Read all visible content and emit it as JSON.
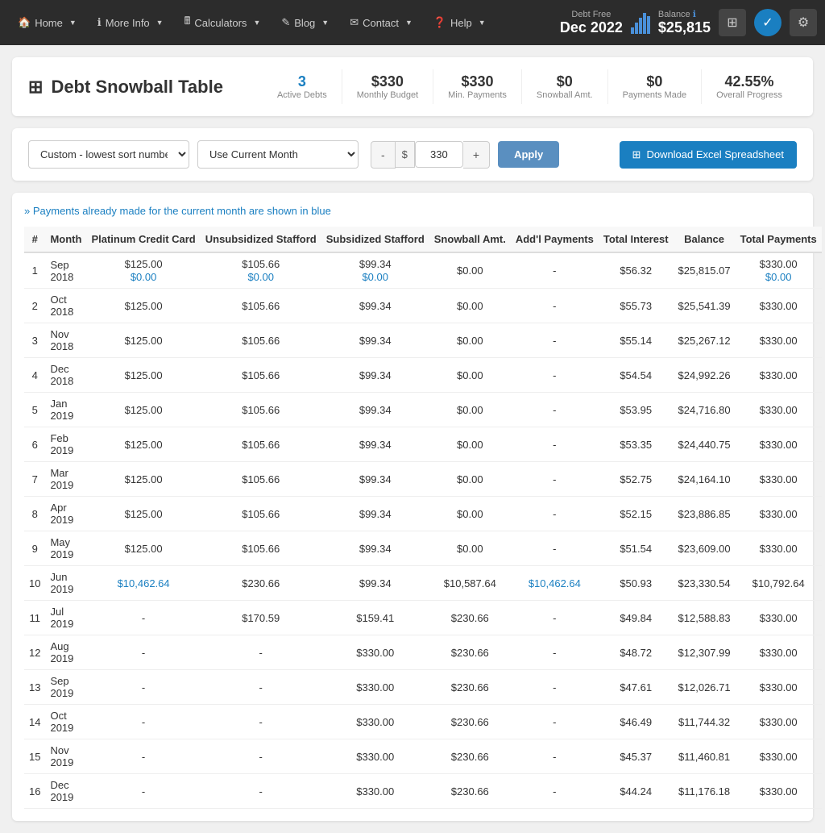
{
  "nav": {
    "home": "Home",
    "more_info": "More Info",
    "calculators": "Calculators",
    "blog": "Blog",
    "contact": "Contact",
    "help": "Help",
    "debt_free_label": "Debt Free",
    "debt_free_date": "Dec 2022",
    "balance_label": "Balance",
    "balance_amount": "$25,815"
  },
  "page": {
    "title": "Debt Snowball Table",
    "stats": [
      {
        "value": "3",
        "label": "Active Debts",
        "color": "blue"
      },
      {
        "value": "$330",
        "label": "Monthly Budget",
        "color": "normal"
      },
      {
        "value": "$330",
        "label": "Min. Payments",
        "color": "normal"
      },
      {
        "value": "$0",
        "label": "Snowball Amt.",
        "color": "normal"
      },
      {
        "value": "$0",
        "label": "Payments Made",
        "color": "normal"
      },
      {
        "value": "42.55%",
        "label": "Overall Progress",
        "color": "normal"
      }
    ]
  },
  "controls": {
    "sort_label": "Custom - lowest sort number ↑",
    "month_label": "Use Current Month",
    "minus": "-",
    "dollar": "$",
    "amount": "330",
    "plus": "+",
    "apply": "Apply",
    "download": "Download Excel Spreadsheet"
  },
  "table": {
    "note": "» Payments already made for the current month are shown in blue",
    "headers": [
      "#",
      "Month",
      "Platinum Credit Card",
      "Unsubsidized Stafford",
      "Subsidized Stafford",
      "Snowball Amt.",
      "Add'l Payments",
      "Total Interest",
      "Balance",
      "Total Payments"
    ],
    "rows": [
      {
        "num": "1",
        "month": "Sep 2018",
        "platinum": "$125.00",
        "platinum2": "$0.00",
        "unstafford": "$105.66",
        "unstafford2": "$0.00",
        "substaffold": "$99.34",
        "substaffold2": "$0.00",
        "snowball": "$0.00",
        "addl": "-",
        "interest": "$56.32",
        "balance": "$25,815.07",
        "total": "$330.00",
        "total2": "$0.00",
        "blue_row": true
      },
      {
        "num": "2",
        "month": "Oct 2018",
        "platinum": "$125.00",
        "unstafford": "$105.66",
        "substaffold": "$99.34",
        "snowball": "$0.00",
        "addl": "-",
        "interest": "$55.73",
        "balance": "$25,541.39",
        "total": "$330.00",
        "blue_row": false
      },
      {
        "num": "3",
        "month": "Nov 2018",
        "platinum": "$125.00",
        "unstafford": "$105.66",
        "substaffold": "$99.34",
        "snowball": "$0.00",
        "addl": "-",
        "interest": "$55.14",
        "balance": "$25,267.12",
        "total": "$330.00",
        "blue_row": false
      },
      {
        "num": "4",
        "month": "Dec 2018",
        "platinum": "$125.00",
        "unstafford": "$105.66",
        "substaffold": "$99.34",
        "snowball": "$0.00",
        "addl": "-",
        "interest": "$54.54",
        "balance": "$24,992.26",
        "total": "$330.00",
        "blue_row": false
      },
      {
        "num": "5",
        "month": "Jan 2019",
        "platinum": "$125.00",
        "unstafford": "$105.66",
        "substaffold": "$99.34",
        "snowball": "$0.00",
        "addl": "-",
        "interest": "$53.95",
        "balance": "$24,716.80",
        "total": "$330.00",
        "blue_row": false
      },
      {
        "num": "6",
        "month": "Feb 2019",
        "platinum": "$125.00",
        "unstafford": "$105.66",
        "substaffold": "$99.34",
        "snowball": "$0.00",
        "addl": "-",
        "interest": "$53.35",
        "balance": "$24,440.75",
        "total": "$330.00",
        "blue_row": false
      },
      {
        "num": "7",
        "month": "Mar 2019",
        "platinum": "$125.00",
        "unstafford": "$105.66",
        "substaffold": "$99.34",
        "snowball": "$0.00",
        "addl": "-",
        "interest": "$52.75",
        "balance": "$24,164.10",
        "total": "$330.00",
        "blue_row": false
      },
      {
        "num": "8",
        "month": "Apr 2019",
        "platinum": "$125.00",
        "unstafford": "$105.66",
        "substaffold": "$99.34",
        "snowball": "$0.00",
        "addl": "-",
        "interest": "$52.15",
        "balance": "$23,886.85",
        "total": "$330.00",
        "blue_row": false
      },
      {
        "num": "9",
        "month": "May 2019",
        "platinum": "$125.00",
        "unstafford": "$105.66",
        "substaffold": "$99.34",
        "snowball": "$0.00",
        "addl": "-",
        "interest": "$51.54",
        "balance": "$23,609.00",
        "total": "$330.00",
        "blue_row": false
      },
      {
        "num": "10",
        "month": "Jun 2019",
        "platinum": "$10,462.64",
        "unstafford": "$230.66",
        "substaffold": "$99.34",
        "snowball": "$10,587.64",
        "addl": "$10,462.64",
        "interest": "$50.93",
        "balance": "$23,330.54",
        "total": "$10,792.64",
        "blue_row": false,
        "highlight_platinum": true
      },
      {
        "num": "11",
        "month": "Jul 2019",
        "platinum": "-",
        "unstafford": "$170.59",
        "substaffold": "$159.41",
        "snowball": "$230.66",
        "addl": "-",
        "interest": "$49.84",
        "balance": "$12,588.83",
        "total": "$330.00",
        "blue_row": false
      },
      {
        "num": "12",
        "month": "Aug 2019",
        "platinum": "-",
        "unstafford": "-",
        "substaffold": "$330.00",
        "snowball": "$230.66",
        "addl": "-",
        "interest": "$48.72",
        "balance": "$12,307.99",
        "total": "$330.00",
        "blue_row": false
      },
      {
        "num": "13",
        "month": "Sep 2019",
        "platinum": "-",
        "unstafford": "-",
        "substaffold": "$330.00",
        "snowball": "$230.66",
        "addl": "-",
        "interest": "$47.61",
        "balance": "$12,026.71",
        "total": "$330.00",
        "blue_row": false
      },
      {
        "num": "14",
        "month": "Oct 2019",
        "platinum": "-",
        "unstafford": "-",
        "substaffold": "$330.00",
        "snowball": "$230.66",
        "addl": "-",
        "interest": "$46.49",
        "balance": "$11,744.32",
        "total": "$330.00",
        "blue_row": false
      },
      {
        "num": "15",
        "month": "Nov 2019",
        "platinum": "-",
        "unstafford": "-",
        "substaffold": "$330.00",
        "snowball": "$230.66",
        "addl": "-",
        "interest": "$45.37",
        "balance": "$11,460.81",
        "total": "$330.00",
        "blue_row": false
      },
      {
        "num": "16",
        "month": "Dec 2019",
        "platinum": "-",
        "unstafford": "-",
        "substaffold": "$330.00",
        "snowball": "$230.66",
        "addl": "-",
        "interest": "$44.24",
        "balance": "$11,176.18",
        "total": "$330.00",
        "blue_row": false
      }
    ]
  }
}
